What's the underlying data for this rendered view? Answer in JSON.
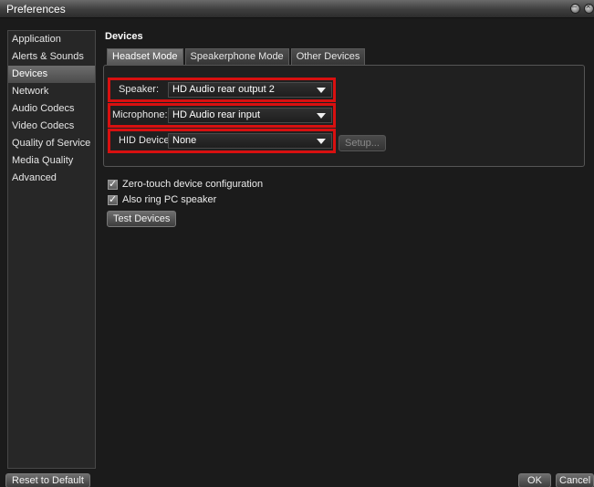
{
  "window": {
    "title": "Preferences"
  },
  "sidebar": {
    "items": [
      {
        "label": "Application"
      },
      {
        "label": "Alerts & Sounds"
      },
      {
        "label": "Devices"
      },
      {
        "label": "Network"
      },
      {
        "label": "Audio Codecs"
      },
      {
        "label": "Video Codecs"
      },
      {
        "label": "Quality of Service"
      },
      {
        "label": "Media Quality"
      },
      {
        "label": "Advanced"
      }
    ],
    "selected": "Devices"
  },
  "main": {
    "section_title": "Devices",
    "tabs": [
      {
        "label": "Headset Mode"
      },
      {
        "label": "Speakerphone Mode"
      },
      {
        "label": "Other Devices"
      }
    ],
    "active_tab": "Headset Mode",
    "speaker": {
      "label": "Speaker:",
      "value": "HD Audio rear output 2"
    },
    "microphone": {
      "label": "Microphone:",
      "value": "HD Audio rear input"
    },
    "hid": {
      "label": "HID Device",
      "value": "None",
      "setup_label": "Setup..."
    },
    "options": {
      "zero_touch": {
        "label": "Zero-touch device configuration",
        "checked": true
      },
      "ring_pc": {
        "label": "Also ring PC speaker",
        "checked": true
      }
    },
    "test_devices_label": "Test Devices"
  },
  "footer": {
    "reset_label": "Reset to Default",
    "ok_label": "OK",
    "cancel_label": "Cancel"
  },
  "colors": {
    "highlight_border": "#d81010"
  },
  "icons": {
    "check": "check-icon",
    "dropdown": "chevron-down-icon",
    "minimize": "minimize-icon",
    "close": "close-icon"
  }
}
